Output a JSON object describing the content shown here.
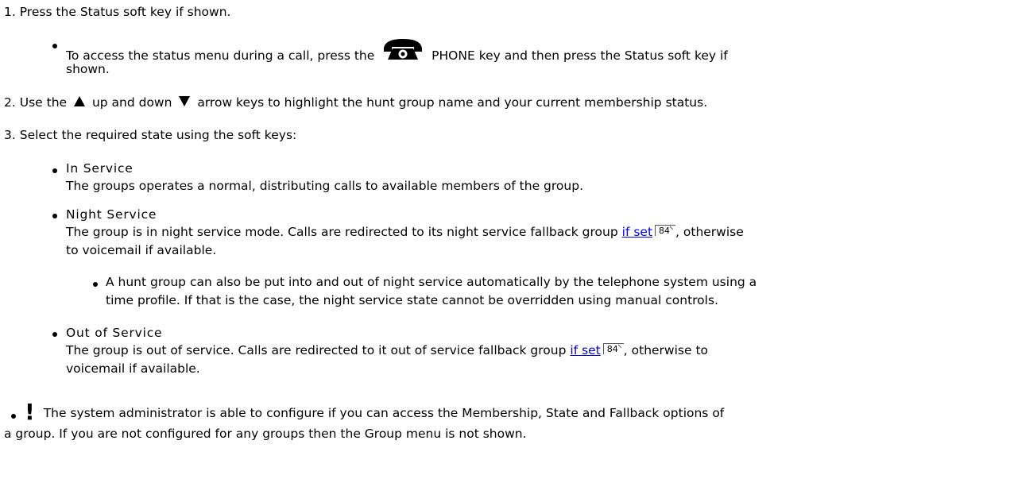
{
  "steps": {
    "s1_num": "1.",
    "s1_text": "Press the Status soft key if shown.",
    "s1_sub_a": "To access the status menu during a call, press the",
    "s1_sub_b": "PHONE key and then press the Status soft key if",
    "s1_sub_c": "shown.",
    "s2_num": "2.",
    "s2_a": "Use the",
    "s2_b": "up and down",
    "s2_c": "arrow keys to highlight the hunt group name and your current membership status.",
    "s3_num": "3.",
    "s3_text": "Select the required state using the soft keys:"
  },
  "options": {
    "in_service_title": "In Service",
    "in_service_desc": "The groups operates a normal, distributing calls to available members of the group.",
    "night_title": "Night Service",
    "night_desc_a": "The group is in night service mode. Calls are redirected to its night service fallback group",
    "night_link": "if set",
    "night_page": "84",
    "night_desc_b": ", otherwise",
    "night_desc_c": "to voicemail if available.",
    "night_note_a": "A hunt group can also be put into and out of night service automatically by the telephone system using a",
    "night_note_b": "time profile. If that is the case, the night service state cannot be overridden using manual controls.",
    "out_title": "Out of Service",
    "out_desc_a": "The group is out of service. Calls are redirected to it out of service fallback group",
    "out_link": "if set",
    "out_page": "84",
    "out_desc_b": ", otherwise to",
    "out_desc_c": "voicemail if available."
  },
  "note": {
    "mark": "!",
    "text_a": "The system administrator is able to configure if you can access the Membership, State and Fallback options of",
    "text_b": "a group. If you are not configured for any groups then the Group menu is not shown."
  },
  "icons": {
    "phone": "phone-icon",
    "up": "up-arrow-icon",
    "down": "down-arrow-icon"
  }
}
